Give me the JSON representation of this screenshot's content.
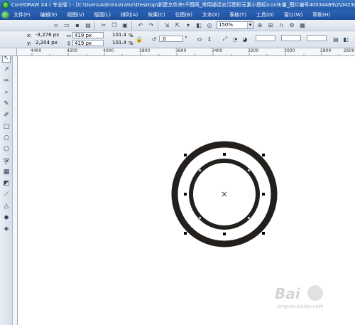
{
  "window": {
    "title": "CorelDRAW X4 ( 专业版 ) - [C:\\Users\\Administrator\\Desktop\\新建文件夹\\千图网_常用通话去污图形元素小图标icon矢量_图片编号40034489\\2\\0423024"
  },
  "menu": {
    "items": [
      "文件(F)",
      "编辑(E)",
      "视图(V)",
      "版面(L)",
      "排列(A)",
      "效果(C)",
      "位图(B)",
      "文本(X)",
      "表格(T)",
      "工具(O)",
      "窗口(W)",
      "帮助(H)"
    ]
  },
  "toolbar": {
    "zoom_value": "150%"
  },
  "property_bar": {
    "x_label": "x:",
    "x_value": "-3,276 px",
    "y_label": "y:",
    "y_value": "2,204 px",
    "width_value": "419 px",
    "height_value": "419 px",
    "scale_x": "101.4",
    "scale_y": "101.4",
    "percent": "%",
    "angle_value": ".0",
    "degree": "°"
  },
  "ruler": {
    "labels": [
      "4400",
      "4200",
      "4000",
      "3800",
      "3600",
      "3400",
      "3200",
      "3000",
      "2800",
      "2600"
    ]
  },
  "watermark": {
    "main": "Bai",
    "sub": "jingyan.baidu.com"
  },
  "colors": {
    "ring": "#231f1c",
    "canvas": "#ffffff",
    "menubar": "#2458a8"
  },
  "icons": {
    "toolbox": [
      "pick-tool",
      "shape-tool",
      "crop-tool",
      "zoom-tool",
      "freehand-tool",
      "smart-fill-tool",
      "rectangle-tool",
      "ellipse-tool",
      "polygon-tool",
      "text-tool",
      "table-tool",
      "interactive-blend-tool",
      "eyedropper-tool",
      "outline-tool",
      "fill-tool",
      "interactive-fill-tool"
    ]
  }
}
